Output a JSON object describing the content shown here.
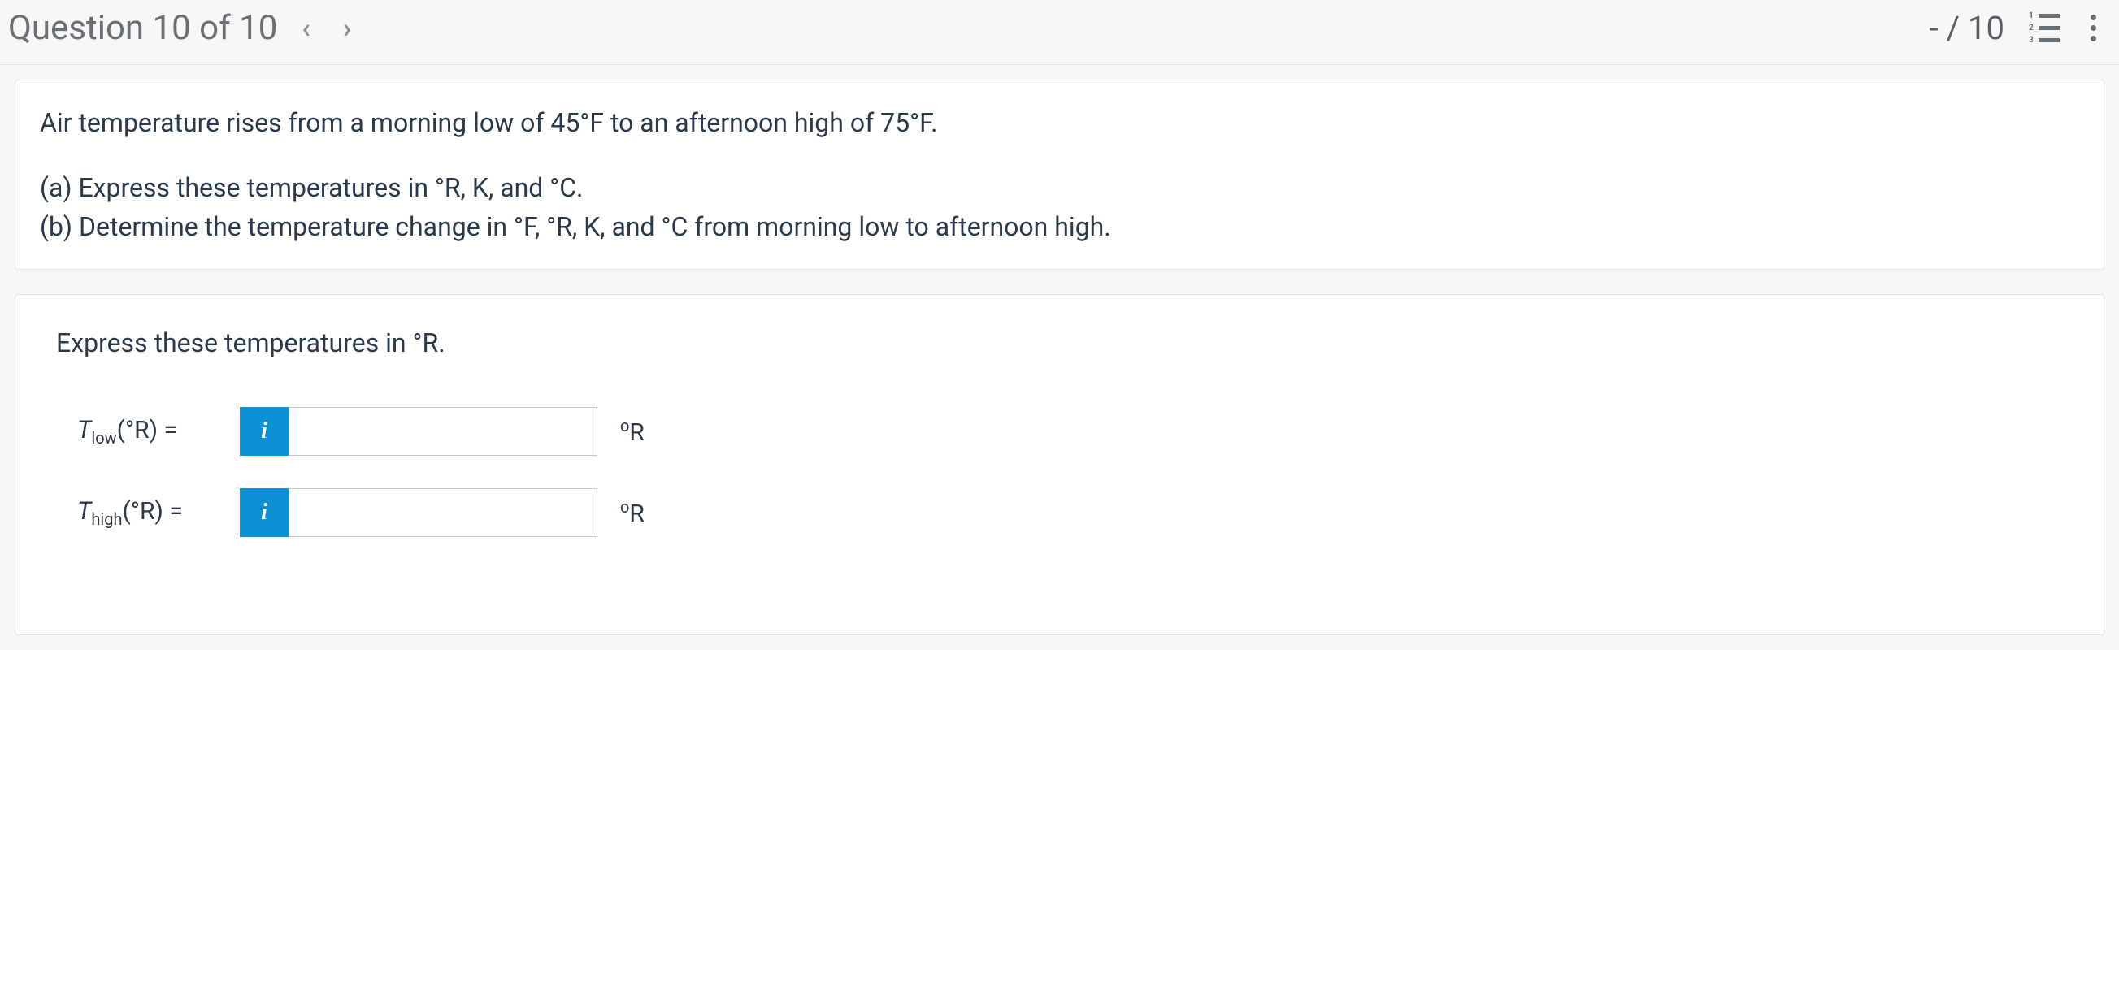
{
  "header": {
    "title": "Question 10 of 10",
    "prev": "‹",
    "next": "›",
    "score": "- / 10"
  },
  "problem": {
    "intro": "Air temperature rises from a morning low of 45°F to an afternoon high of 75°F.",
    "part_a": "(a) Express these temperatures in °R, K, and °C.",
    "part_b": "(b) Determine the temperature change in °F, °R, K, and °C from morning low to afternoon high."
  },
  "part": {
    "instruction": "Express these temperatures in °R.",
    "rows": [
      {
        "symbol": "T",
        "sub": "low",
        "unitParen": "(°R) =",
        "info": "i",
        "unit": "°R",
        "value": ""
      },
      {
        "symbol": "T",
        "sub": "high",
        "unitParen": "(°R) =",
        "info": "i",
        "unit": "°R",
        "value": ""
      }
    ]
  }
}
